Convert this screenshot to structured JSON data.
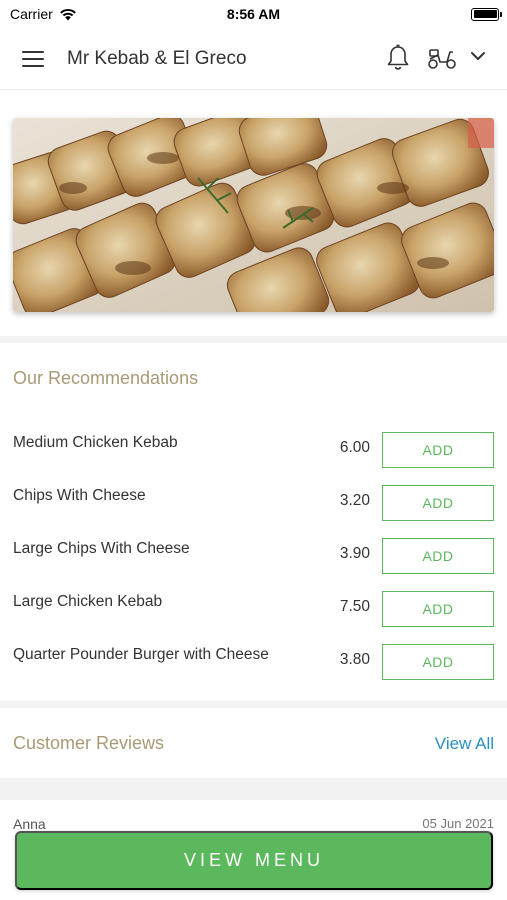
{
  "status_bar": {
    "carrier": "Carrier",
    "time": "8:56 AM"
  },
  "header": {
    "title": "Mr Kebab & El Greco"
  },
  "recommendations": {
    "title": "Our Recommendations",
    "add_label": "ADD",
    "items": [
      {
        "name": "Medium Chicken Kebab",
        "price": "6.00"
      },
      {
        "name": "Chips With Cheese",
        "price": "3.20"
      },
      {
        "name": "Large Chips With Cheese",
        "price": "3.90"
      },
      {
        "name": "Large Chicken Kebab",
        "price": "7.50"
      },
      {
        "name": "Quarter Pounder Burger with Cheese",
        "price": "3.80"
      }
    ]
  },
  "reviews": {
    "title": "Customer Reviews",
    "view_all": "View All",
    "first": {
      "name": "Anna",
      "date": "05 Jun 2021"
    }
  },
  "footer": {
    "view_menu": "VIEW MENU"
  },
  "colors": {
    "accent_green": "#5cb85c",
    "title_tan": "#a99a76",
    "link_blue": "#2a8fbf"
  },
  "icons": [
    "wifi-icon",
    "battery-icon",
    "hamburger-icon",
    "bell-icon",
    "scooter-icon",
    "chevron-down-icon"
  ]
}
